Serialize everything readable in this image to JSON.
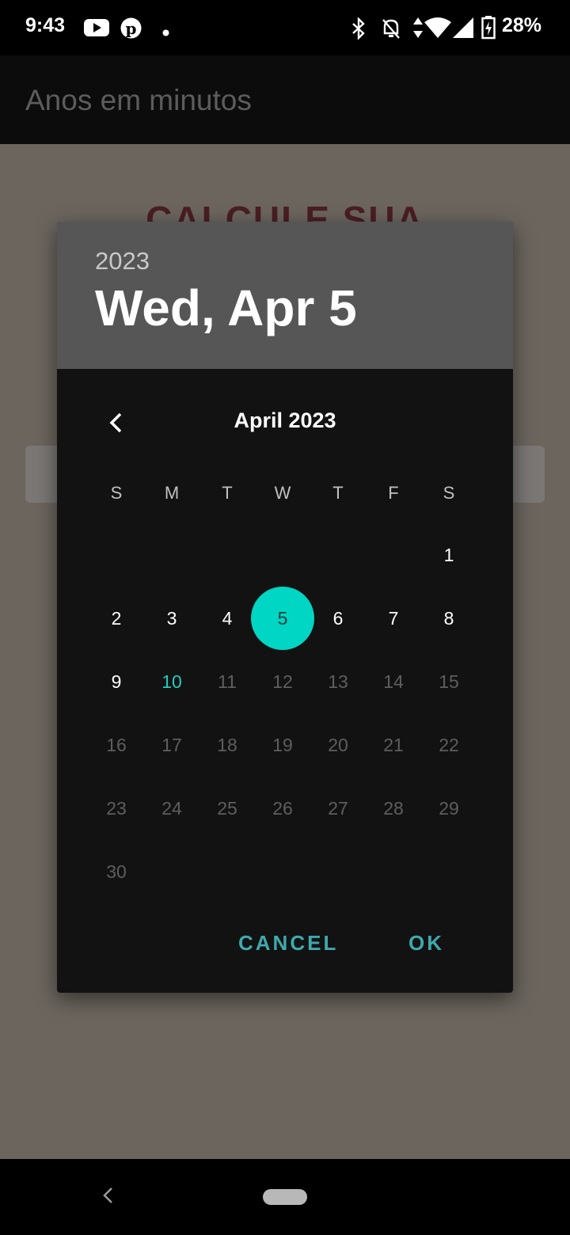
{
  "status_bar": {
    "time": "9:43",
    "battery": "28%",
    "icons": [
      "youtube-icon",
      "pinterest-icon",
      "dot-icon",
      "bluetooth-icon",
      "notifications-off-icon",
      "data-arrows-icon",
      "wifi-icon",
      "signal-icon",
      "battery-charging-icon"
    ]
  },
  "app_bar": {
    "title": "Anos em minutos"
  },
  "background": {
    "heading": "CALCULE SUA"
  },
  "dialog": {
    "year": "2023",
    "selected_date": "Wed, Apr 5",
    "month_title": "April 2023",
    "weekdays": [
      "S",
      "M",
      "T",
      "W",
      "T",
      "F",
      "S"
    ],
    "days": [
      "1",
      "2",
      "3",
      "4",
      "5",
      "6",
      "7",
      "8",
      "9",
      "10",
      "11",
      "12",
      "13",
      "14",
      "15",
      "16",
      "17",
      "18",
      "19",
      "20",
      "21",
      "22",
      "23",
      "24",
      "25",
      "26",
      "27",
      "28",
      "29",
      "30"
    ],
    "selected_day": "5",
    "today_day": "10",
    "cancel_label": "CANCEL",
    "ok_label": "OK"
  },
  "colors": {
    "accent": "#00d6c4",
    "today": "#1ecdc0",
    "button_text": "#3fa9ad"
  }
}
